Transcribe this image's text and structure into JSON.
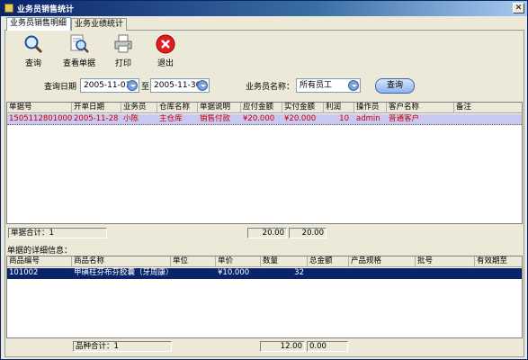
{
  "window": {
    "title": "业务员销售统计",
    "close_glyph": "✕"
  },
  "tabs": [
    {
      "label": "业务员销售明细",
      "active": true
    },
    {
      "label": "业务业绩统计",
      "active": false
    }
  ],
  "toolbar": {
    "query": {
      "label": "查询",
      "icon": "magnifier-icon"
    },
    "view_doc": {
      "label": "查看单据",
      "icon": "document-search-icon"
    },
    "print": {
      "label": "打印",
      "icon": "printer-icon"
    },
    "exit": {
      "label": "退出",
      "icon": "exit-icon"
    }
  },
  "filters": {
    "date_label": "查询日期",
    "date_from": "2005-11-01",
    "to_label": "至",
    "date_to": "2005-11-30",
    "salesperson_label": "业务员名称：",
    "salesperson_value": "所有员工",
    "query_button": "查询"
  },
  "main_grid": {
    "columns": [
      "单据号",
      "开单日期",
      "业务员",
      "仓库名称",
      "单据说明",
      "应付金额",
      "实付金额",
      "利润",
      "操作员",
      "客户名称",
      "备注"
    ],
    "rows": [
      [
        "15051128010001",
        "2005-11-28",
        "小陈",
        "主仓库",
        "销售付款",
        "¥20.000",
        "¥20.000",
        "10",
        "admin",
        "普通客户",
        ""
      ]
    ],
    "selected_text_color": "#cc0000",
    "selected_bg": "#c8c8f0"
  },
  "main_summary": {
    "count_label": "单据合计：1",
    "payable_total": "20.00",
    "paid_total": "20.00"
  },
  "detail_section_label": "单据的详细信息：",
  "detail_grid": {
    "columns": [
      "商品编号",
      "商品名称",
      "单位",
      "单价",
      "数量",
      "总金额",
      "产品规格",
      "批号",
      "有效期至"
    ],
    "rows": [
      [
        "101002",
        "甲磺柱芬布芬胶囊（牙周康）盒",
        "",
        "¥10.000",
        "32",
        "",
        "",
        "",
        ""
      ]
    ],
    "selected_bg": "#0a246a",
    "selected_text_color": "#ffffff"
  },
  "detail_summary": {
    "count_label": "品种合计：1",
    "qty_total": "12.00",
    "amount_total": "0.00"
  }
}
